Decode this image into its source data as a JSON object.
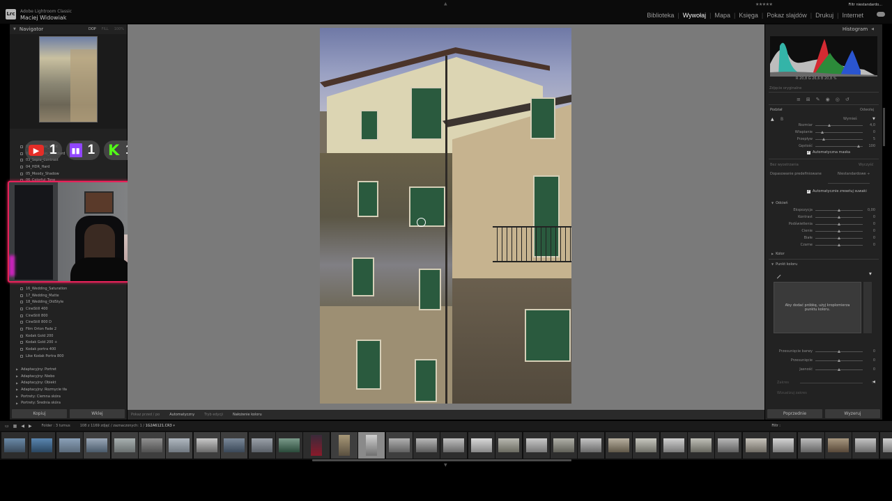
{
  "app": {
    "logo_text": "Lrc",
    "name": "Adobe Lightroom Classic",
    "user": "Maciej Widowiak"
  },
  "modules": [
    "Biblioteka",
    "Wywołaj",
    "Mapa",
    "Księga",
    "Pokaz slajdów",
    "Drukuj",
    "Internet"
  ],
  "active_module": "Wywołaj",
  "navigator": {
    "title": "Navigator",
    "options": [
      "DOP",
      "FILL",
      "100%"
    ]
  },
  "presets_top": [
    "01_Pistachio_Light",
    "02_Pistachio_Standard",
    "03_Sepia_Contrast",
    "04_HDR_Hard",
    "05_Moody_Shadow",
    "06_Colorful_Tone"
  ],
  "presets_bottom": [
    "16_Wedding_Saturation",
    "17_Wedding_Matte",
    "18_Wedding_OldStyle",
    "CineStill 400",
    "CineStill 800",
    "CineStill 800 D",
    "Film Orton Fade 2",
    "Kodak Gold 200",
    "Kodak Gold 200 +",
    "Kodak portra 400",
    "Like Kodak Portra 800"
  ],
  "preset_groups": [
    "Adaptacyjny: Portret",
    "Adaptacyjny: Niebo",
    "Adaptacyjny: Obiekt",
    "Adaptacyjny: Rozmycie tła",
    "Portrety: Ciemna skóra",
    "Portrety: Średnia skóra"
  ],
  "left_buttons": {
    "copy": "Kopiuj",
    "paste": "Wklej"
  },
  "social": {
    "youtube": {
      "icon": "youtube-icon",
      "count": "1",
      "color": "#e52d27"
    },
    "twitch": {
      "icon": "twitch-icon",
      "count": "1",
      "color": "#9146ff"
    },
    "kick": {
      "icon": "kick-icon",
      "glyph": "K",
      "count": "1",
      "color": "#53fc18"
    }
  },
  "toolbar": {
    "items": [
      "Pokaz przed / po",
      "Automatyczny",
      "Tryb edycji",
      "Nałożenie koloru"
    ]
  },
  "right_panel": {
    "histogram_title": "Histogram",
    "readout": "R 20,8   G 26,6   B 20,8 %",
    "original_photo": "Zdjęcie oryginalne",
    "mask_section": {
      "title": "Podział",
      "action": "Odwołaj",
      "mode": "Wymieś"
    },
    "mask_sliders": [
      {
        "label": "Rozmiar",
        "value": "4,0",
        "pos": 0.3
      },
      {
        "label": "Wtapianie",
        "value": "0",
        "pos": 0.15
      },
      {
        "label": "Przepływ",
        "value": "5",
        "pos": 0.18
      },
      {
        "label": "Gęstość",
        "value": "100",
        "pos": 0.92
      }
    ],
    "auto_mask": "Automatyczna maska",
    "cleanup": {
      "label": "Bez wyostrzania",
      "action": "Wyczyść"
    },
    "preset_row": {
      "label": "Dopasowanie predefiniowane",
      "value": "Niestandardowe ÷"
    },
    "auto_reset": "Automatycznie zresetuj suwaki",
    "tone_section": "Odcień",
    "tone_sliders": [
      {
        "label": "Ekspozycja",
        "value": "0,00"
      },
      {
        "label": "Kontrast",
        "value": "0"
      },
      {
        "label": "Podświetlenia",
        "value": "0"
      },
      {
        "label": "Cienie",
        "value": "0"
      },
      {
        "label": "Białe",
        "value": "0"
      },
      {
        "label": "Czarne",
        "value": "0"
      }
    ],
    "color_section": "Kolor",
    "point_color_section": "Punkt koloru",
    "color_box_text": "Aby dodać próbkę, użyj kroplomierza punktu koloru.",
    "bottom_sliders": [
      {
        "label": "Przesunięcie barwy",
        "value": "0"
      },
      {
        "label": "Przesunięcie",
        "value": "0"
      },
      {
        "label": "Jasność",
        "value": "0"
      }
    ],
    "amount": {
      "label": "Zakres",
      "value": "0"
    },
    "visualize": "Wizualizuj zakres",
    "buttons": {
      "previous": "Poprzednie",
      "reset": "Wyzeruj"
    }
  },
  "film_bar": {
    "folder": "Folder : 3 turnus",
    "count_prefix": "108 z 1169 zdjęć / zaznaczonych: 1 /",
    "filename": "1G2A6121.CR3",
    "filter_label": "Filtr :",
    "filter_value": "Filtr niestandardo..."
  }
}
